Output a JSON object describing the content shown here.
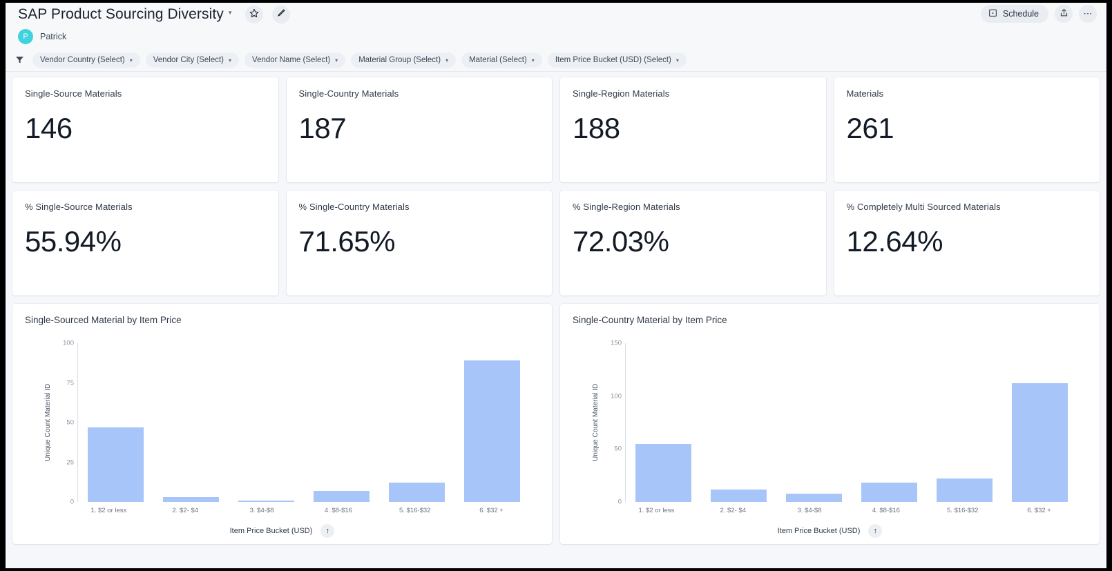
{
  "header": {
    "title": "SAP Product Sourcing Diversity",
    "title_caret": "▾",
    "favorite_icon": "star-icon",
    "edit_icon": "pencil-icon",
    "owner": {
      "initial": "P",
      "name": "Patrick"
    },
    "schedule_label": "Schedule",
    "schedule_icon": "calendar-icon",
    "share_icon": "share-icon",
    "more_icon": "ellipsis-icon"
  },
  "filters": {
    "filter_icon": "funnel-icon",
    "chips": [
      {
        "label": "Vendor Country (Select)",
        "caret": "▾"
      },
      {
        "label": "Vendor City (Select)",
        "caret": "▾"
      },
      {
        "label": "Vendor Name (Select)",
        "caret": "▾"
      },
      {
        "label": "Material Group (Select)",
        "caret": "▾"
      },
      {
        "label": "Material (Select)",
        "caret": "▾"
      },
      {
        "label": "Item Price Bucket (USD) (Select)",
        "caret": "▾"
      }
    ]
  },
  "kpis_row1": [
    {
      "label": "Single-Source Materials",
      "value": "146"
    },
    {
      "label": "Single-Country Materials",
      "value": "187"
    },
    {
      "label": "Single-Region Materials",
      "value": "188"
    },
    {
      "label": "Materials",
      "value": "261"
    }
  ],
  "kpis_row2": [
    {
      "label": "% Single-Source Materials",
      "value": "55.94%"
    },
    {
      "label": "% Single-Country Materials",
      "value": "71.65%"
    },
    {
      "label": "% Single-Region Materials",
      "value": "72.03%"
    },
    {
      "label": "% Completely Multi Sourced Materials",
      "value": "12.64%"
    }
  ],
  "chart_data": [
    {
      "type": "bar",
      "title": "Single-Sourced Material by Item Price",
      "xlabel": "Item Price Bucket (USD)",
      "ylabel": "Unique Count Material ID",
      "sort_icon": "sort-ascending-icon",
      "categories": [
        "1. $2 or less",
        "2. $2- $4",
        "3. $4-$8",
        "4. $8-$16",
        "5. $16-$32",
        "6. $32 +"
      ],
      "values": [
        47,
        3,
        1,
        7,
        12,
        89
      ],
      "yticks": [
        0,
        25,
        50,
        75,
        100
      ],
      "ylim": [
        0,
        100
      ],
      "grid": false,
      "legend": "none",
      "bar_color": "#a8c5fa"
    },
    {
      "type": "bar",
      "title": "Single-Country Material by Item Price",
      "xlabel": "Item Price Bucket (USD)",
      "ylabel": "Unique Count Material ID",
      "sort_icon": "sort-ascending-icon",
      "categories": [
        "1. $2 or less",
        "2. $2- $4",
        "3. $4-$8",
        "4. $8-$16",
        "5. $16-$32",
        "6. $32 +"
      ],
      "values": [
        55,
        12,
        8,
        18,
        22,
        112
      ],
      "yticks": [
        0,
        50,
        100,
        150
      ],
      "ylim": [
        0,
        150
      ],
      "grid": false,
      "legend": "none",
      "bar_color": "#a8c5fa"
    }
  ]
}
